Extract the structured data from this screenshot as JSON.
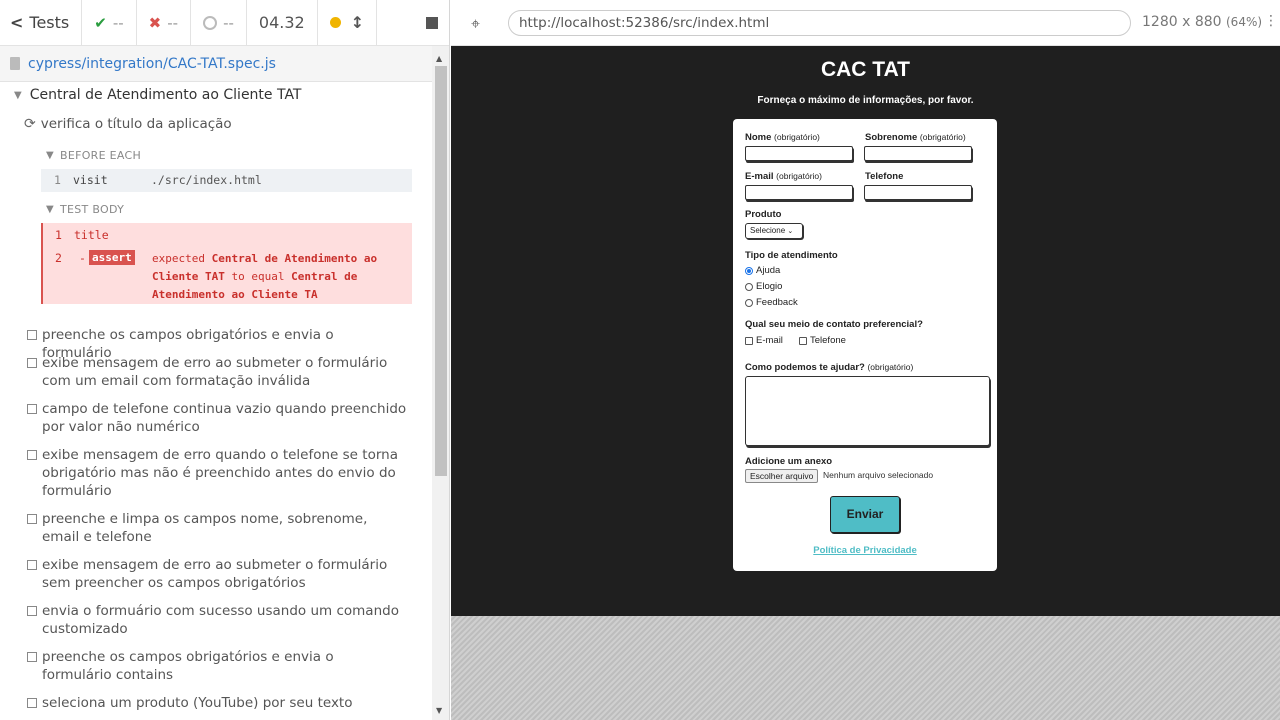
{
  "stats": {
    "tests_label": "Tests",
    "passed": "--",
    "failed": "--",
    "pending": "--",
    "duration": "04.32"
  },
  "spec": {
    "path": "cypress/integration/CAC-TAT.spec.js"
  },
  "suite": {
    "title": "Central de Atendimento ao Cliente TAT",
    "current_test": "verifica o título da aplicação",
    "before_each_label": "BEFORE EACH",
    "before_each_cmd": {
      "num": "1",
      "name": "visit",
      "message": "./src/index.html"
    },
    "test_body_label": "TEST BODY",
    "body_cmd1": {
      "num": "1",
      "name": "title"
    },
    "body_cmd2": {
      "num": "2",
      "dash": "-",
      "name": "assert",
      "expected_word": "expected",
      "expected_value": "Central de Atendimento ao Cliente TAT",
      "to_equal": "to equal",
      "actual_value": "Central de Atendimento ao Cliente TA"
    },
    "pending_tests": [
      "preenche os campos obrigatórios e envia o formulário",
      "exibe mensagem de erro ao submeter o formulário com um email com formatação inválida",
      "campo de telefone continua vazio quando preenchido por valor não numérico",
      "exibe mensagem de erro quando o telefone se torna obrigatório mas não é preenchido antes do envio do formulário",
      "preenche e limpa os campos nome, sobrenome, email e telefone",
      "exibe mensagem de erro ao submeter o formulário sem preencher os campos obrigatórios",
      "envia o formuário com sucesso usando um comando customizado",
      "preenche os campos obrigatórios e envia o formulário contains",
      "seleciona um produto (YouTube) por seu texto"
    ]
  },
  "aut": {
    "url": "http://localhost:52386/src/index.html",
    "viewport": "1280 x 880",
    "scale": "(64%)"
  },
  "app": {
    "title": "CAC TAT",
    "subtitle": "Forneça o máximo de informações, por favor.",
    "nome_label": "Nome",
    "sobrenome_label": "Sobrenome",
    "email_label": "E-mail",
    "telefone_label": "Telefone",
    "required_hint": "(obrigatório)",
    "produto_label": "Produto",
    "produto_selected": "Selecione",
    "tipo_label": "Tipo de atendimento",
    "tipo_options": [
      "Ajuda",
      "Elogio",
      "Feedback"
    ],
    "contato_label": "Qual seu meio de contato preferencial?",
    "contato_options": [
      "E-mail",
      "Telefone"
    ],
    "ajuda_label": "Como podemos te ajudar?",
    "anexo_label": "Adicione um anexo",
    "file_button": "Escolher arquivo",
    "file_none": "Nenhum arquivo selecionado",
    "submit": "Enviar",
    "privacy": "Política de Privacidade"
  }
}
